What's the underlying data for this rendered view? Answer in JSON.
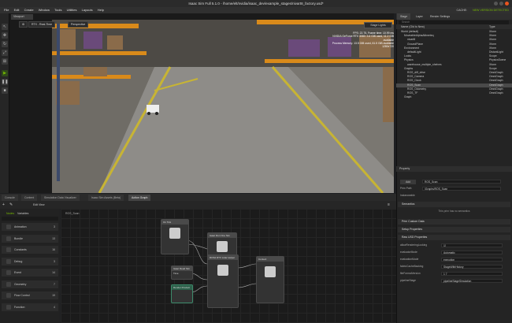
{
  "title": "Isaac Sim Full 5.1.0 - /home/elt/nvidia/isaac_dev/example_stages/nivart8_factory.usd*",
  "menu": [
    "File",
    "Edit",
    "Create",
    "Window",
    "Tools",
    "Utilities",
    "Layouts",
    "Help"
  ],
  "cache_label": "CACHE:",
  "new_version": "NEW VERSION DETECTED",
  "viewport": {
    "tab": "Viewport",
    "render_mode": "RTX - Real-Time",
    "camera": "Perspective",
    "stage_lights": "Stage Lights",
    "stats": [
      "FPS: 22.75, Frame time: 10.99 ms",
      "NVIDIA GeForce RTX 3080: 3.6 GiB used, 11.2 GiB available",
      "Process Memory: 13.5 GiB used, 61.5 GiB available",
      "1280x720"
    ]
  },
  "stage": {
    "tabs": [
      "Stage",
      "Layer",
      "Render Settings"
    ],
    "col_name": "Name (Old to New)",
    "col_type": "Type",
    "rows": [
      {
        "name": "World (default)",
        "type": "Xform"
      },
      {
        "name": "MoveableAlphaAltimeteq",
        "type": "Xform"
      },
      {
        "name": "nivart8",
        "type": "Xform"
      },
      {
        "name": "GroundPlane",
        "type": "Xform"
      },
      {
        "name": "Environment",
        "type": "Xform"
      },
      {
        "name": "defaultLight",
        "type": "DistantLight"
      },
      {
        "name": "Looks",
        "type": "Scope"
      },
      {
        "name": "Physics",
        "type": "PhysicsScene"
      },
      {
        "name": "warehouse_multiple_shelves",
        "type": "Xform"
      },
      {
        "name": "Graphs",
        "type": "Scope"
      },
      {
        "name": "ROS_diff_drive",
        "type": "OmniGraph"
      },
      {
        "name": "ROS_Camera",
        "type": "OmniGraph"
      },
      {
        "name": "ROS_Clock",
        "type": "OmniGraph"
      },
      {
        "name": "ROS_Scan",
        "type": "OmniGraph"
      },
      {
        "name": "ROS_Odometry",
        "type": "OmniGraph"
      },
      {
        "name": "ROS_TF",
        "type": "OmniGraph"
      },
      {
        "name": "Graph",
        "type": ""
      }
    ],
    "selected_row": 13,
    "search_placeholder": "Search"
  },
  "property": {
    "tab": "Property",
    "add_label": "Add",
    "add_value": "ROS_Scan",
    "prim_path_label": "Prim Path",
    "prim_path": "/Graphs/ROS_Scan",
    "instanceable_label": "Instanceable",
    "sections": [
      "Semantics",
      "Prim Custom Data",
      "Setup Properties",
      "Raw USD Properties"
    ],
    "no_semantics": "This prim has no semantics",
    "raw": [
      {
        "label": "allowRenderingLocking",
        "value": "☑"
      },
      {
        "label": "evaluatorMode",
        "value": "Automatic"
      },
      {
        "label": "evaluationMode",
        "value": "execution"
      },
      {
        "label": "fabricCacheBacking",
        "value": "StageWithHistory"
      },
      {
        "label": "fileFormatVersion",
        "value": "1  7"
      },
      {
        "label": "pipelineStage",
        "value": "pipelineStageSimulation"
      }
    ]
  },
  "bottom_tabs": [
    "Console",
    "Content",
    "Simulation Data Visualizer",
    "Isaac Sim Assets (Beta)",
    "Action Graph"
  ],
  "graph": {
    "path": "Edit   View",
    "breadcrumb": "ROS_Scan",
    "lib_tabs": [
      "Nodes",
      "Variables"
    ],
    "library": [
      {
        "name": "Animation",
        "count": "3"
      },
      {
        "name": "Bundle",
        "count": "13"
      },
      {
        "name": "Constants",
        "count": "16"
      },
      {
        "name": "Debug",
        "count": "3"
      },
      {
        "name": "Event",
        "count": "14"
      },
      {
        "name": "Geometry",
        "count": "7"
      },
      {
        "name": "Flow Control",
        "count": "19"
      },
      {
        "name": "Function",
        "count": "4"
      }
    ],
    "nodes": [
      "On Tick",
      "Isaac Run One Sim",
      "Isaac Read Sim Time",
      "Render Product",
      "ROS2 RTX Lidar Helper",
      "Context",
      "ROS2 QoS Profile"
    ]
  },
  "accent": "#76b900"
}
